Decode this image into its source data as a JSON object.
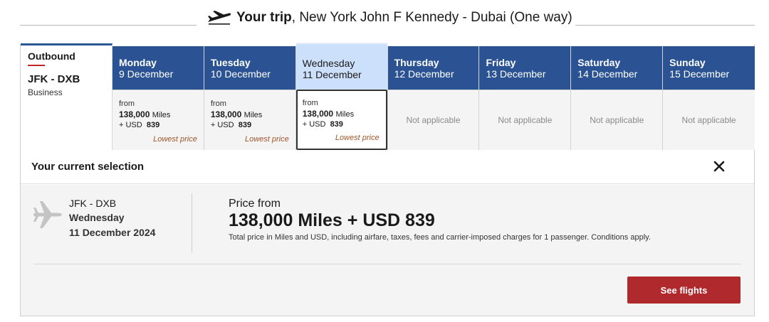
{
  "trip": {
    "title_bold": "Your trip",
    "title_rest": ", New York John F Kennedy - Dubai (One way)"
  },
  "outbound": {
    "label": "Outbound",
    "route": "JFK - DXB",
    "cabin": "Business"
  },
  "days": [
    {
      "day": "Monday",
      "date": "9 December",
      "from": "from",
      "miles": "138,000",
      "miles_unit": "Miles",
      "usd_prefix": "+  USD",
      "usd": "839",
      "note": "Lowest price"
    },
    {
      "day": "Tuesday",
      "date": "10 December",
      "from": "from",
      "miles": "138,000",
      "miles_unit": "Miles",
      "usd_prefix": "+  USD",
      "usd": "839",
      "note": "Lowest price"
    },
    {
      "day": "Wednesday",
      "date": "11 December",
      "from": "from",
      "miles": "138,000",
      "miles_unit": "Miles",
      "usd_prefix": "+  USD",
      "usd": "839",
      "note": "Lowest price"
    },
    {
      "day": "Thursday",
      "date": "12 December",
      "na": "Not applicable"
    },
    {
      "day": "Friday",
      "date": "13 December",
      "na": "Not applicable"
    },
    {
      "day": "Saturday",
      "date": "14 December",
      "na": "Not applicable"
    },
    {
      "day": "Sunday",
      "date": "15 December",
      "na": "Not applicable"
    }
  ],
  "selection": {
    "title": "Your current selection",
    "route": "JFK - DXB",
    "day": "Wednesday",
    "date": "11 December 2024",
    "price_from": "Price from",
    "price": "138,000 Miles + USD 839",
    "note": "Total price in Miles and USD, including airfare, taxes, fees and carrier-imposed charges for 1 passenger. Conditions apply.",
    "button": "See flights"
  },
  "icons": {
    "header_plane": "plane-takeoff-icon",
    "selection_plane": "plane-icon",
    "close": "close-icon"
  },
  "colors": {
    "header_blue": "#2b5393",
    "selected_blue": "#cde0fb",
    "accent_red": "#b0292d",
    "lowest_price": "#a0552a"
  }
}
